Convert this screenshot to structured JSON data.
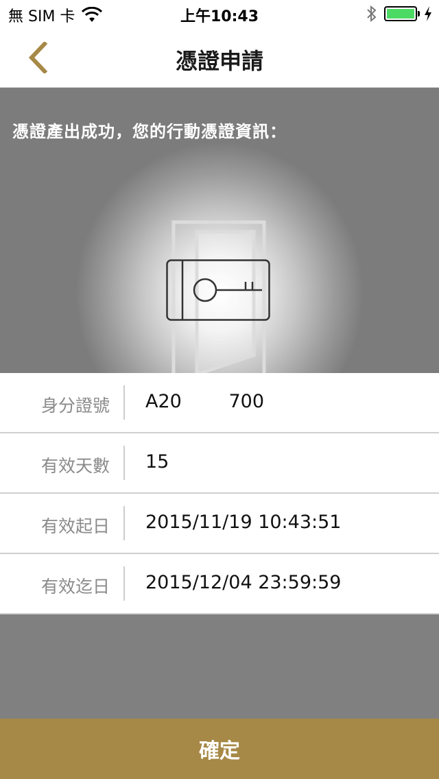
{
  "status_bar": {
    "carrier": "無 SIM 卡",
    "time": "上午10:43",
    "battery_level": 1.0,
    "battery_color": "#4cd964"
  },
  "nav": {
    "title": "憑證申請",
    "back_icon": "chevron-left-icon",
    "accent_color": "#a68946"
  },
  "hero": {
    "message": "憑證產出成功，您的行動憑證資訊：",
    "illustration": "key-card-icon"
  },
  "info": {
    "rows": [
      {
        "label": "身分證號",
        "value": "A20        700"
      },
      {
        "label": "有效天數",
        "value": "15"
      },
      {
        "label": "有效起日",
        "value": "2015/11/19 10:43:51"
      },
      {
        "label": "有效迄日",
        "value": "2015/12/04 23:59:59"
      }
    ]
  },
  "confirm": {
    "label": "確定"
  }
}
